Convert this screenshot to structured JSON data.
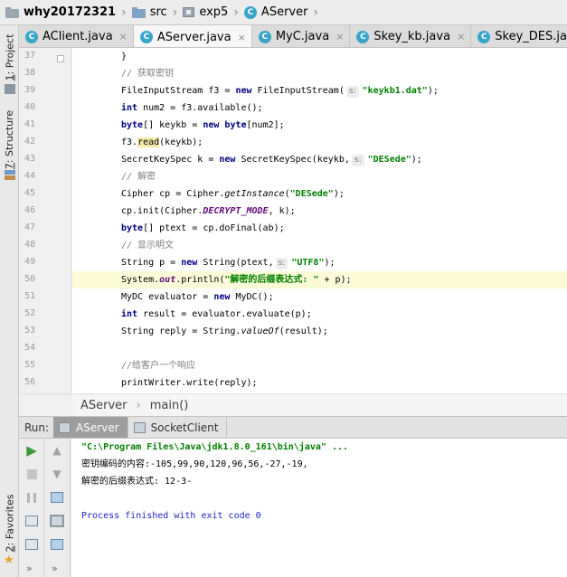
{
  "breadcrumb": {
    "project": "why20172321",
    "folders": [
      "src",
      "exp5"
    ],
    "file": "AServer"
  },
  "tool_windows": {
    "project": {
      "number": "1",
      "label": "Project"
    },
    "structure": {
      "number": "7",
      "label": "Structure"
    },
    "favorites": {
      "number": "2",
      "label": "Favorites"
    }
  },
  "tabs": [
    {
      "label": "AClient.java",
      "active": false
    },
    {
      "label": "AServer.java",
      "active": true
    },
    {
      "label": "MyC.java",
      "active": false
    },
    {
      "label": "Skey_kb.java",
      "active": false
    },
    {
      "label": "Skey_DES.java",
      "active": false
    }
  ],
  "icons": {
    "class_letter": "C",
    "close": "×"
  },
  "editor": {
    "line_numbers": [
      "37",
      "38",
      "39",
      "40",
      "41",
      "42",
      "43",
      "44",
      "45",
      "46",
      "47",
      "48",
      "49",
      "50",
      "51",
      "52",
      "53",
      "54",
      "55",
      "56"
    ],
    "highlighted_line": "50",
    "code": {
      "l37_brace": "}",
      "l38_comment": "// 获取密钥",
      "l39_a": "FileInputStream f3 = ",
      "l39_new": "new",
      "l39_b": " FileInputStream(",
      "l39_hint": "s:",
      "l39_str": "\"keykb1.dat\"",
      "l39_c": ");",
      "l40_kw": "int",
      "l40_b": " num2 = f3.available();",
      "l41_kw1": "byte",
      "l41_b": "[] keykb = ",
      "l41_kw2": "new",
      "l41_sp": " ",
      "l41_kw3": "byte",
      "l41_c": "[num2];",
      "l42_a": "f3.",
      "l42_mark": "read",
      "l42_b": "(keykb);",
      "l43_a": "SecretKeySpec k = ",
      "l43_new": "new",
      "l43_b": " SecretKeySpec(keykb,",
      "l43_hint": "s:",
      "l43_str": "\"DESede\"",
      "l43_c": ");",
      "l44_comment": "// 解密",
      "l45_a": "Cipher cp = Cipher.",
      "l45_it": "getInstance",
      "l45_b": "(",
      "l45_str": "\"DESede\"",
      "l45_c": ");",
      "l46_a": "cp.init(Cipher.",
      "l46_fld": "DECRYPT_MODE",
      "l46_b": ", k);",
      "l47_kw": "byte",
      "l47_b": "[] ptext = cp.doFinal(ab);",
      "l48_comment": "// 显示明文",
      "l49_a": "String p = ",
      "l49_new": "new",
      "l49_b": " String(ptext,",
      "l49_hint": "s:",
      "l49_str": "\"UTF8\"",
      "l49_c": ");",
      "l50_a": "System.",
      "l50_fld": "out",
      "l50_b": ".println(",
      "l50_str": "\"解密的后缀表达式: \"",
      "l50_c": " + p);",
      "l51_a": "MyDC evaluator = ",
      "l51_new": "new",
      "l51_b": " MyDC();",
      "l52_kw": "int",
      "l52_b": " result = evaluator.evaluate(p);",
      "l53_a": "String reply = String.",
      "l53_it": "valueOf",
      "l53_b": "(result);",
      "l55_comment": "//给客户一个响应",
      "l56_a": "printWriter.write(reply);"
    }
  },
  "editor_breadcrumb": {
    "class": "AServer",
    "method": "main()"
  },
  "run_panel": {
    "label": "Run:",
    "tabs": [
      {
        "label": "AServer",
        "active": true
      },
      {
        "label": "SocketClient",
        "active": false
      }
    ],
    "more": "»"
  },
  "console": {
    "command": "\"C:\\Program Files\\Java\\jdk1.8.0_161\\bin\\java\" ...",
    "line1": "密钥编码的内容:-105,99,90,120,96,56,-27,-19,",
    "line2": "解密的后缀表达式: 12-3-",
    "exit": "Process finished with exit code 0"
  }
}
